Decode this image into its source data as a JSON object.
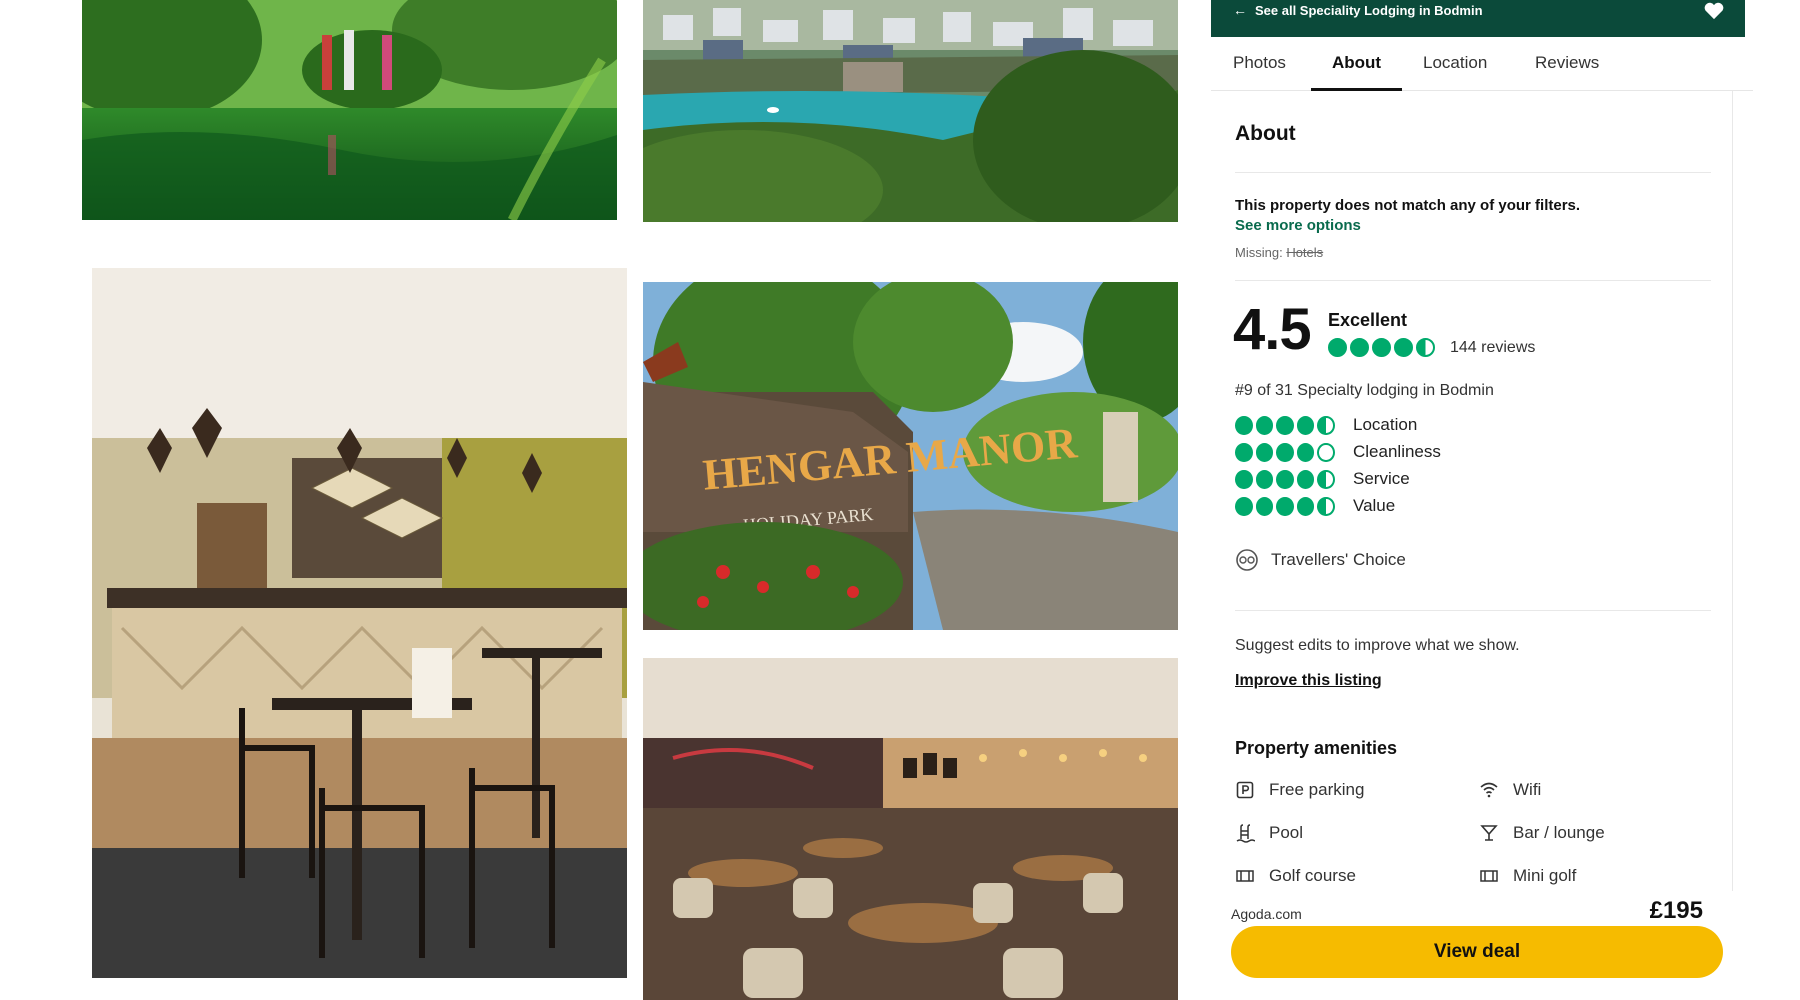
{
  "topbar": {
    "back_label": "See all Speciality Lodging in Bodmin"
  },
  "tabs": [
    "Photos",
    "About",
    "Location",
    "Reviews"
  ],
  "about": {
    "title": "About",
    "filter_message": "This property does not match any of your filters.",
    "see_more": "See more options",
    "missing_label": "Missing:",
    "missing_value": "Hotels"
  },
  "rating": {
    "score": "4.5",
    "word": "Excellent",
    "bubbles": 4.5,
    "reviews": "144 reviews",
    "rank": "#9 of 31 Specialty lodging in Bodmin",
    "categories": [
      {
        "label": "Location",
        "bubbles": 4.5
      },
      {
        "label": "Cleanliness",
        "bubbles": 4
      },
      {
        "label": "Service",
        "bubbles": 4.5
      },
      {
        "label": "Value",
        "bubbles": 4.5
      }
    ],
    "travellers_choice": "Travellers' Choice"
  },
  "suggest": {
    "text": "Suggest edits to improve what we show.",
    "link": "Improve this listing"
  },
  "amenities": {
    "title": "Property amenities",
    "items": [
      {
        "label": "Free parking",
        "icon": "parking-icon"
      },
      {
        "label": "Wifi",
        "icon": "wifi-icon"
      },
      {
        "label": "Pool",
        "icon": "pool-icon"
      },
      {
        "label": "Bar / lounge",
        "icon": "cocktail-icon"
      },
      {
        "label": "Golf course",
        "icon": "golf-icon"
      },
      {
        "label": "Mini golf",
        "icon": "mini-golf-icon"
      }
    ]
  },
  "deal": {
    "provider": "Agoda.com",
    "price": "£195",
    "button": "View deal"
  },
  "photos": {
    "sign_text": "HENGAR MANOR",
    "sign_subtext": "HOLIDAY PARK"
  },
  "colors": {
    "brand_green": "#0b4a3a",
    "bubble_green": "#00aa6c",
    "link_green": "#0a6b4d",
    "deal_yellow": "#f6bb00"
  }
}
